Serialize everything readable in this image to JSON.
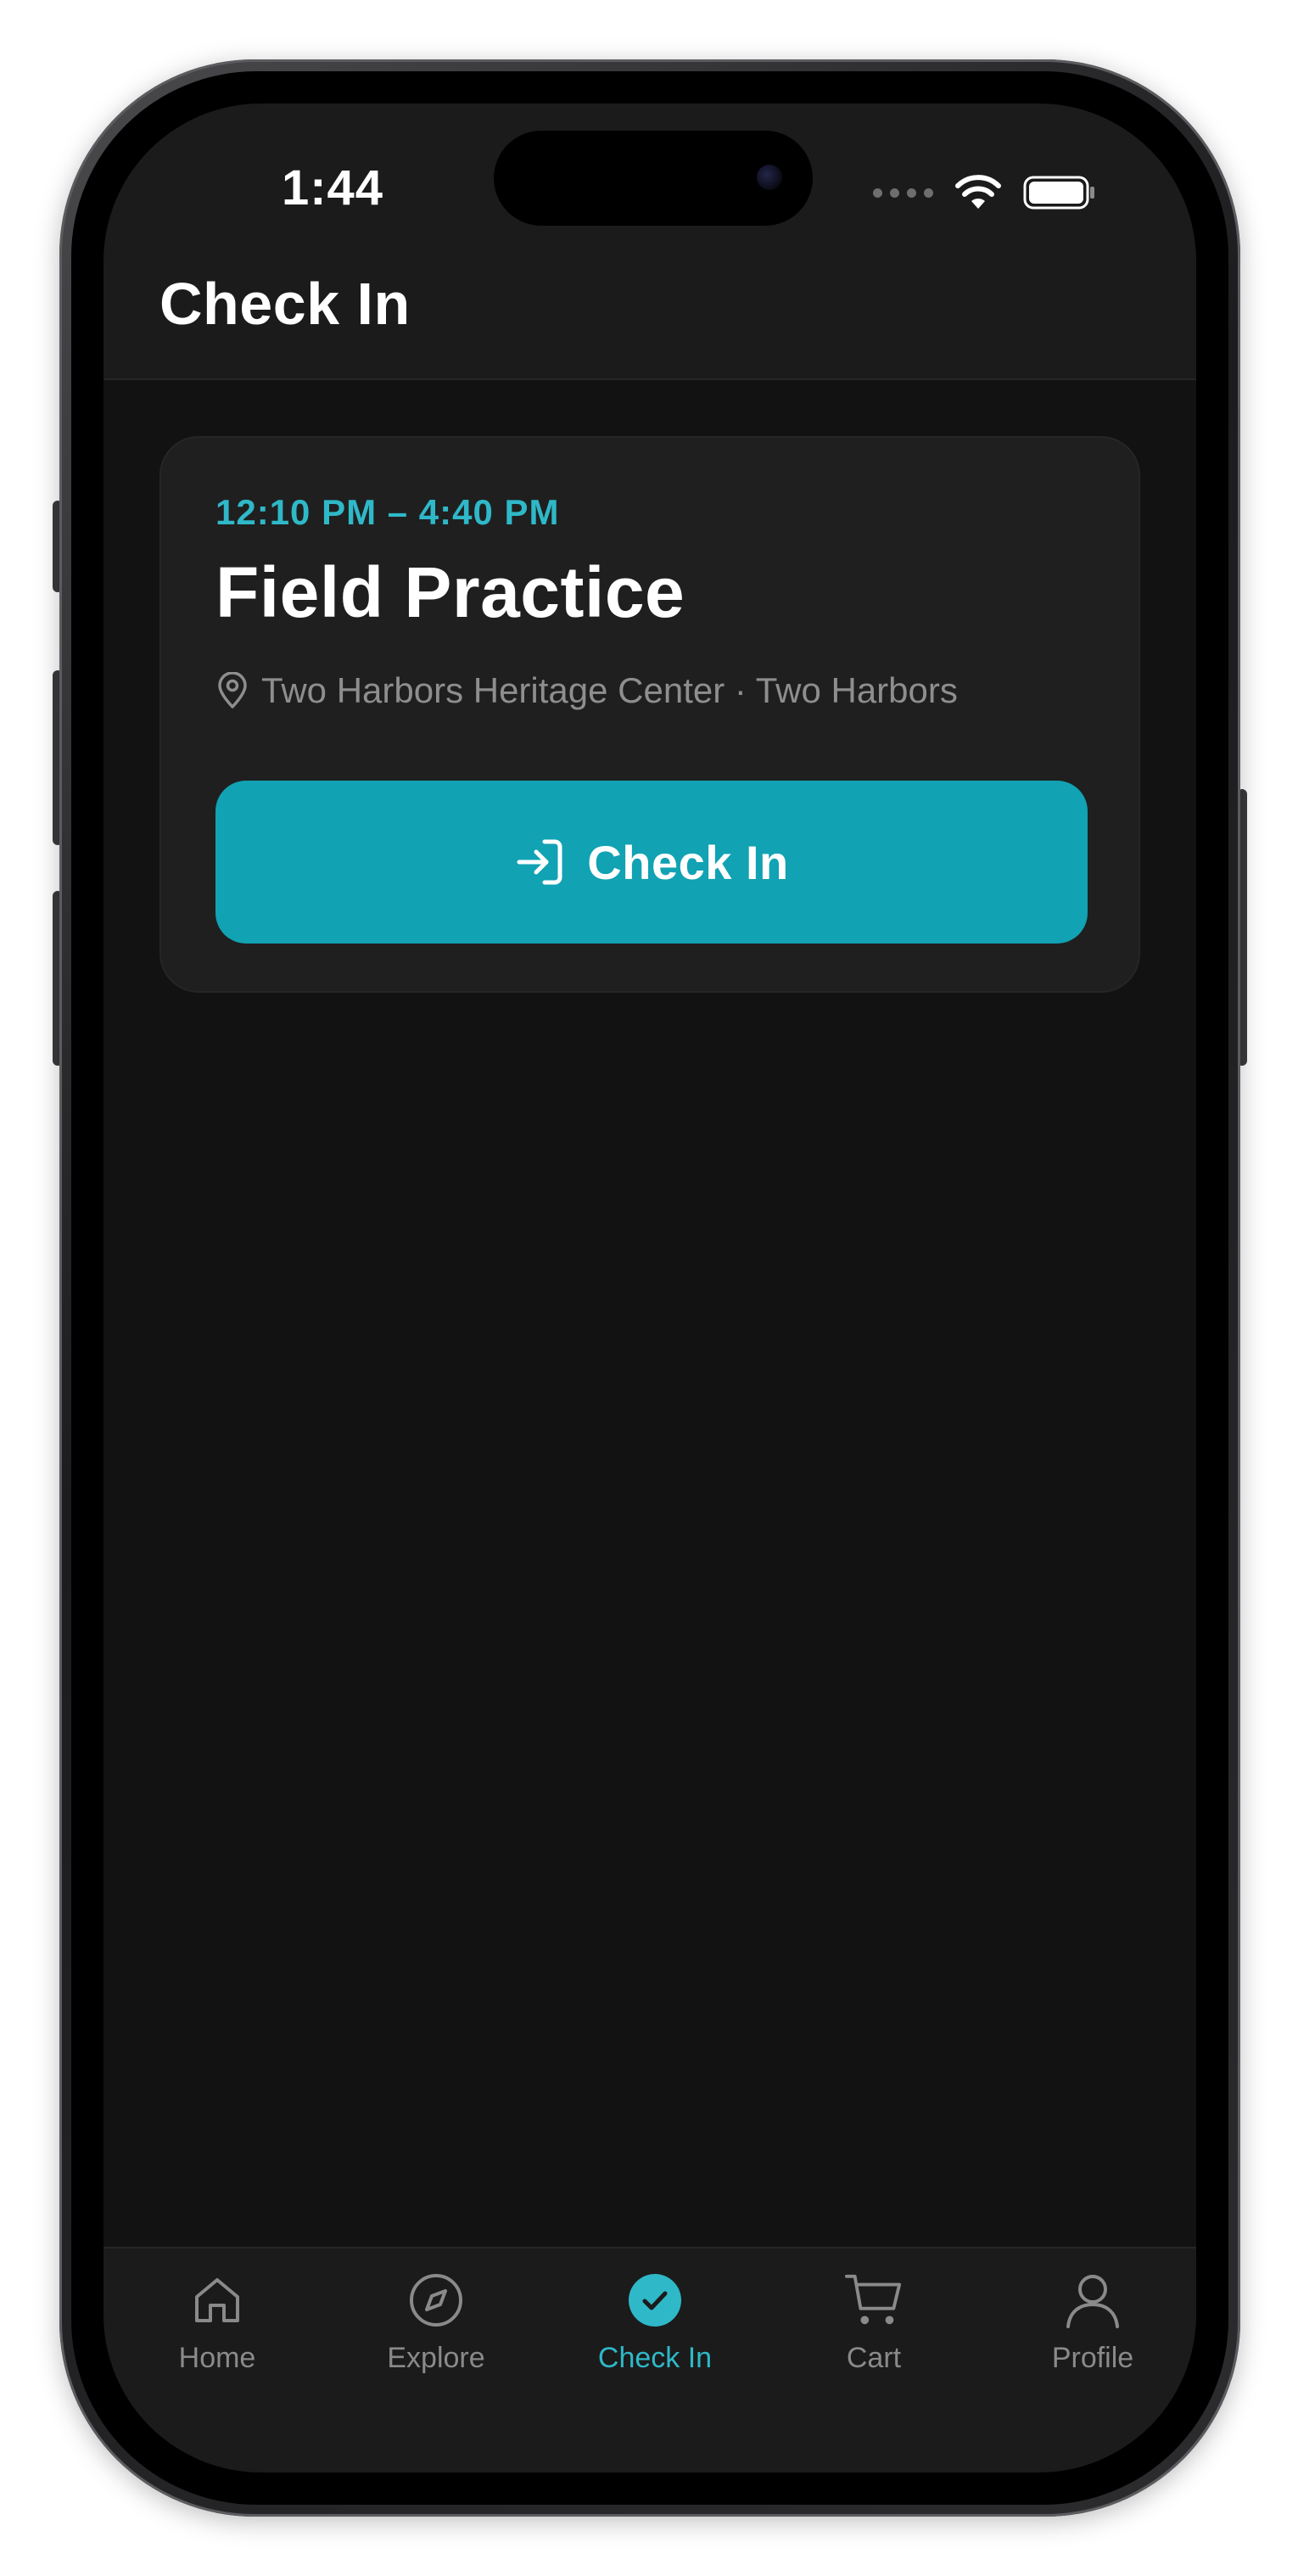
{
  "status_bar": {
    "time": "1:44"
  },
  "header": {
    "title": "Check In"
  },
  "event": {
    "time_range": "12:10 PM – 4:40 PM",
    "title": "Field Practice",
    "location": "Two Harbors Heritage Center · Two Harbors",
    "checkin_label": "Check In"
  },
  "tab_bar": {
    "tabs": [
      {
        "label": "Home",
        "icon": "home-icon",
        "active": false
      },
      {
        "label": "Explore",
        "icon": "compass-icon",
        "active": false
      },
      {
        "label": "Check In",
        "icon": "checkmark-circle-icon",
        "active": true
      },
      {
        "label": "Cart",
        "icon": "cart-icon",
        "active": false
      },
      {
        "label": "Profile",
        "icon": "person-icon",
        "active": false
      }
    ]
  },
  "colors": {
    "accent": "#2fb8c8",
    "button": "#11a2b3",
    "background": "#121212",
    "card": "#1f1f1f"
  }
}
